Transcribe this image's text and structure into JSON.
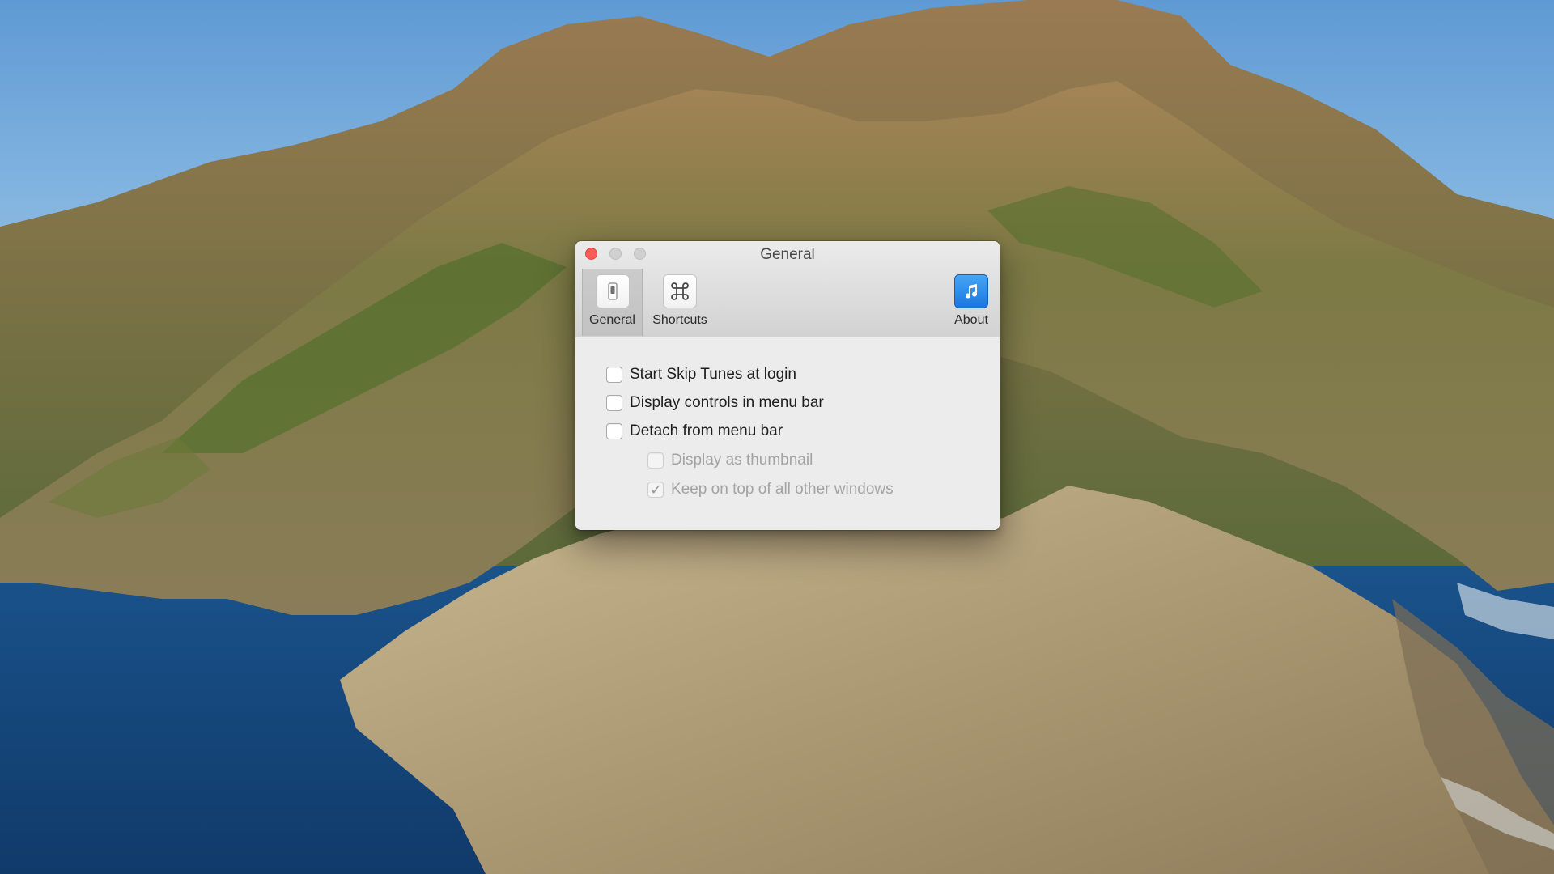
{
  "window": {
    "title": "General"
  },
  "toolbar": {
    "items": [
      {
        "label": "General",
        "icon": "switch-icon",
        "selected": true
      },
      {
        "label": "Shortcuts",
        "icon": "command-icon",
        "selected": false
      },
      {
        "label": "About",
        "icon": "music-note-icon",
        "selected": false
      }
    ]
  },
  "options": [
    {
      "label": "Start Skip Tunes at login",
      "checked": false,
      "enabled": true
    },
    {
      "label": "Display controls in menu bar",
      "checked": false,
      "enabled": true
    },
    {
      "label": "Detach from menu bar",
      "checked": false,
      "enabled": true
    },
    {
      "label": "Display as thumbnail",
      "checked": false,
      "enabled": false
    },
    {
      "label": "Keep on top of all other windows",
      "checked": true,
      "enabled": false
    }
  ],
  "colors": {
    "close": "#fc5b57",
    "about_icon": "#1a76de"
  }
}
